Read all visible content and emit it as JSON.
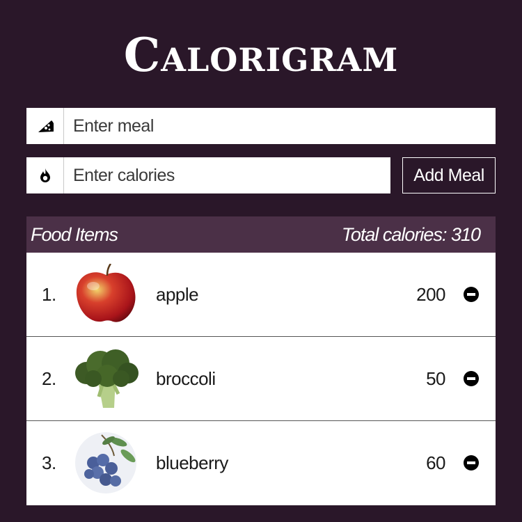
{
  "app": {
    "title": "Calorigram"
  },
  "form": {
    "meal_placeholder": "Enter meal",
    "calories_placeholder": "Enter calories",
    "meal_icon": "pizza-icon",
    "calories_icon": "flame-icon",
    "add_label": "Add Meal"
  },
  "list": {
    "header_label": "Food Items",
    "total_label": "Total calories: 310",
    "items": [
      {
        "index": "1.",
        "name": "apple",
        "calories": "200",
        "image": "apple-image"
      },
      {
        "index": "2.",
        "name": "broccoli",
        "calories": "50",
        "image": "broccoli-image"
      },
      {
        "index": "3.",
        "name": "blueberry",
        "calories": "60",
        "image": "blueberry-image"
      }
    ]
  },
  "colors": {
    "background": "#2a1729",
    "header": "#4b3047",
    "surface": "#ffffff"
  }
}
